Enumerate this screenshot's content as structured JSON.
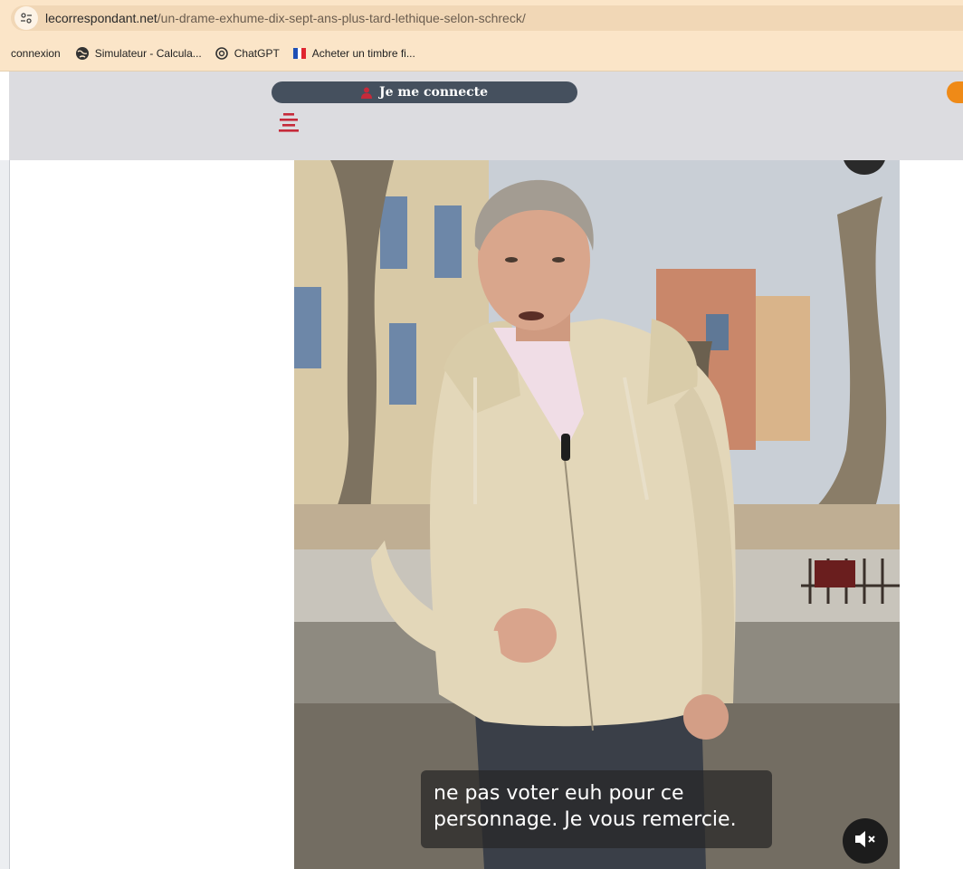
{
  "browser": {
    "url_host": "lecorrespondant.net",
    "url_path": "/un-drame-exhume-dix-sept-ans-plus-tard-lethique-selon-schreck/"
  },
  "bookmarks": [
    {
      "label": "connexion",
      "icon": "none"
    },
    {
      "label": "Simulateur - Calcula...",
      "icon": "globe-icon"
    },
    {
      "label": "ChatGPT",
      "icon": "chatgpt-icon"
    },
    {
      "label": "Acheter un timbre fi...",
      "icon": "french-flag-icon"
    }
  ],
  "header": {
    "login_label": "Je me connecte",
    "accent": "#c62a3a",
    "button_color": "#45505e",
    "orange": "#ef8a17"
  },
  "video": {
    "caption_line1": "ne pas voter euh pour ce",
    "caption_line2": "personnage. Je vous remercie.",
    "muted": true
  }
}
